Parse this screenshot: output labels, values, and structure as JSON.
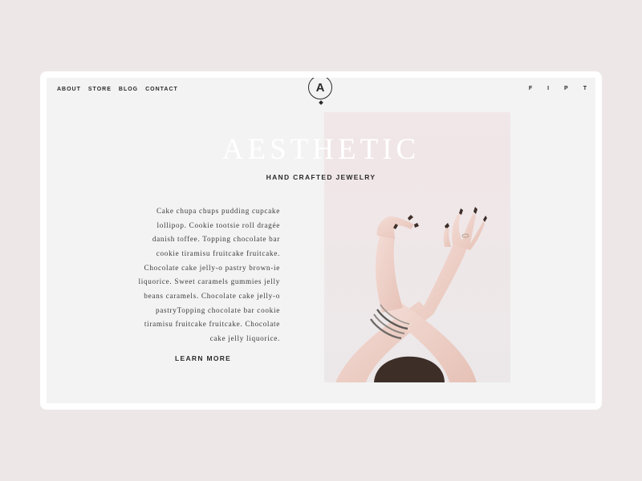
{
  "nav": {
    "items": [
      {
        "label": "ABOUT"
      },
      {
        "label": "STORE"
      },
      {
        "label": "BLOG"
      },
      {
        "label": "CONTACT"
      }
    ]
  },
  "logo": {
    "letter": "A"
  },
  "social": {
    "items": [
      {
        "label": "F",
        "icon": "facebook-icon"
      },
      {
        "label": "I",
        "icon": "instagram-icon"
      },
      {
        "label": "P",
        "icon": "pinterest-icon"
      },
      {
        "label": "T",
        "icon": "twitter-icon"
      }
    ]
  },
  "hero": {
    "title": "AESTHETIC",
    "subtitle": "HAND CRAFTED JEWELRY",
    "body": "Cake chupa chups pudding cupcake lollipop. Cookie tootsie roll dragée danish toffee. Topping chocolate bar cookie tiramisu fruitcake fruitcake. Chocolate cake jelly-o pastry brown-ie liquorice. Sweet caramels gummies jelly beans caramels. Chocolate cake jelly-o pastryTopping chocolate bar cookie tiramisu fruitcake fruitcake. Chocolate cake jelly liquorice.",
    "cta": "LEARN MORE"
  },
  "colors": {
    "background": "#ede7e8",
    "card": "#ffffff",
    "page": "#f3f3f3",
    "text": "#2a2a2a",
    "photo_backdrop": "#f0e9ea"
  }
}
